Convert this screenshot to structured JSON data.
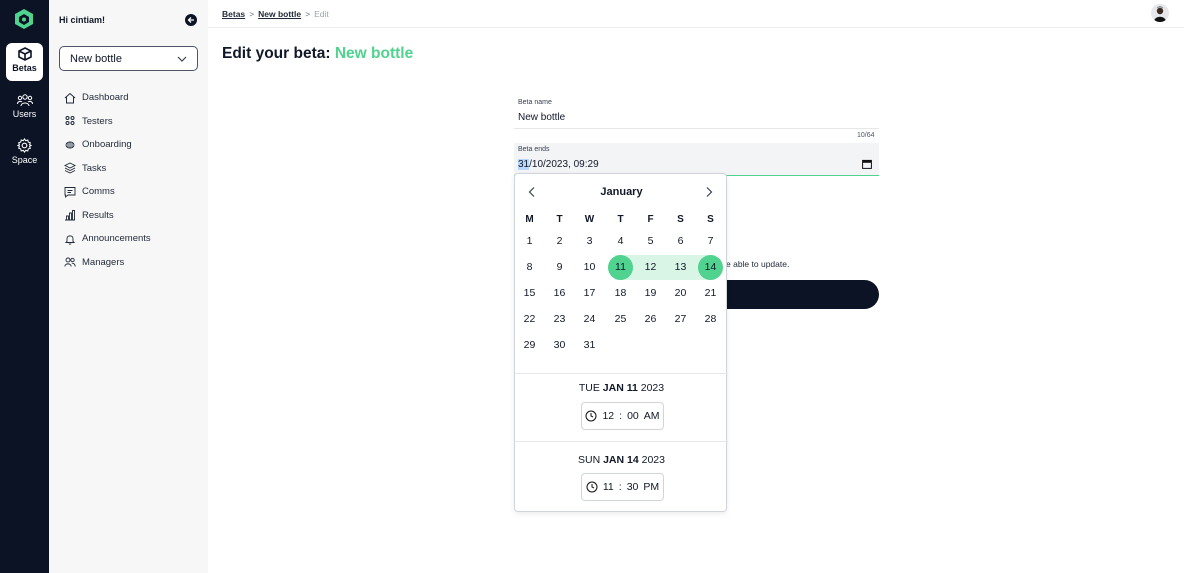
{
  "rail": {
    "items": [
      {
        "label": "Betas",
        "icon": "box-icon",
        "active": true
      },
      {
        "label": "Users",
        "icon": "users-icon",
        "active": false
      },
      {
        "label": "Space",
        "icon": "gear-icon",
        "active": false
      }
    ]
  },
  "sidebar": {
    "greeting": "Hi cintiam!",
    "beta_select": "New bottle",
    "items": [
      {
        "label": "Dashboard",
        "icon": "home-icon"
      },
      {
        "label": "Testers",
        "icon": "testers-icon"
      },
      {
        "label": "Onboarding",
        "icon": "onboarding-icon"
      },
      {
        "label": "Tasks",
        "icon": "layers-icon"
      },
      {
        "label": "Comms",
        "icon": "chat-icon"
      },
      {
        "label": "Results",
        "icon": "bar-chart-icon"
      },
      {
        "label": "Announcements",
        "icon": "bell-icon"
      },
      {
        "label": "Managers",
        "icon": "managers-icon"
      }
    ]
  },
  "breadcrumb": {
    "root": "Betas",
    "middle": "New bottle",
    "current": "Edit",
    "sep": ">"
  },
  "title": {
    "prefix": "Edit your beta:",
    "accent": "New bottle"
  },
  "form": {
    "beta_name_label": "Beta name",
    "beta_name_value": "New bottle",
    "counter": "10/64",
    "beta_ends_label": "Beta ends",
    "beta_ends_day": "31",
    "beta_ends_rest": "/10/2023, 09:29",
    "partial_text": "e able to update."
  },
  "calendar": {
    "month": "January",
    "weekdays": [
      "M",
      "T",
      "W",
      "T",
      "F",
      "S",
      "S"
    ],
    "weeks": [
      [
        "1",
        "2",
        "3",
        "4",
        "5",
        "6",
        "7"
      ],
      [
        "8",
        "9",
        "10",
        "11",
        "12",
        "13",
        "14"
      ],
      [
        "15",
        "16",
        "17",
        "18",
        "19",
        "20",
        "21"
      ],
      [
        "22",
        "23",
        "24",
        "25",
        "26",
        "27",
        "28"
      ],
      [
        "29",
        "30",
        "31",
        "",
        "",
        "",
        ""
      ]
    ],
    "range_start": "11",
    "range_end": "14",
    "start": {
      "weekday": "TUE",
      "month_day": "JAN 11",
      "year": "2023",
      "hour": "12",
      "minute": "00",
      "ampm": "AM"
    },
    "end": {
      "weekday": "SUN",
      "month_day": "JAN 14",
      "year": "2023",
      "hour": "11",
      "minute": "30",
      "ampm": "PM"
    }
  },
  "colors": {
    "accent": "#4fd38e",
    "dark": "#0b1324",
    "range": "#d8f5e6"
  }
}
